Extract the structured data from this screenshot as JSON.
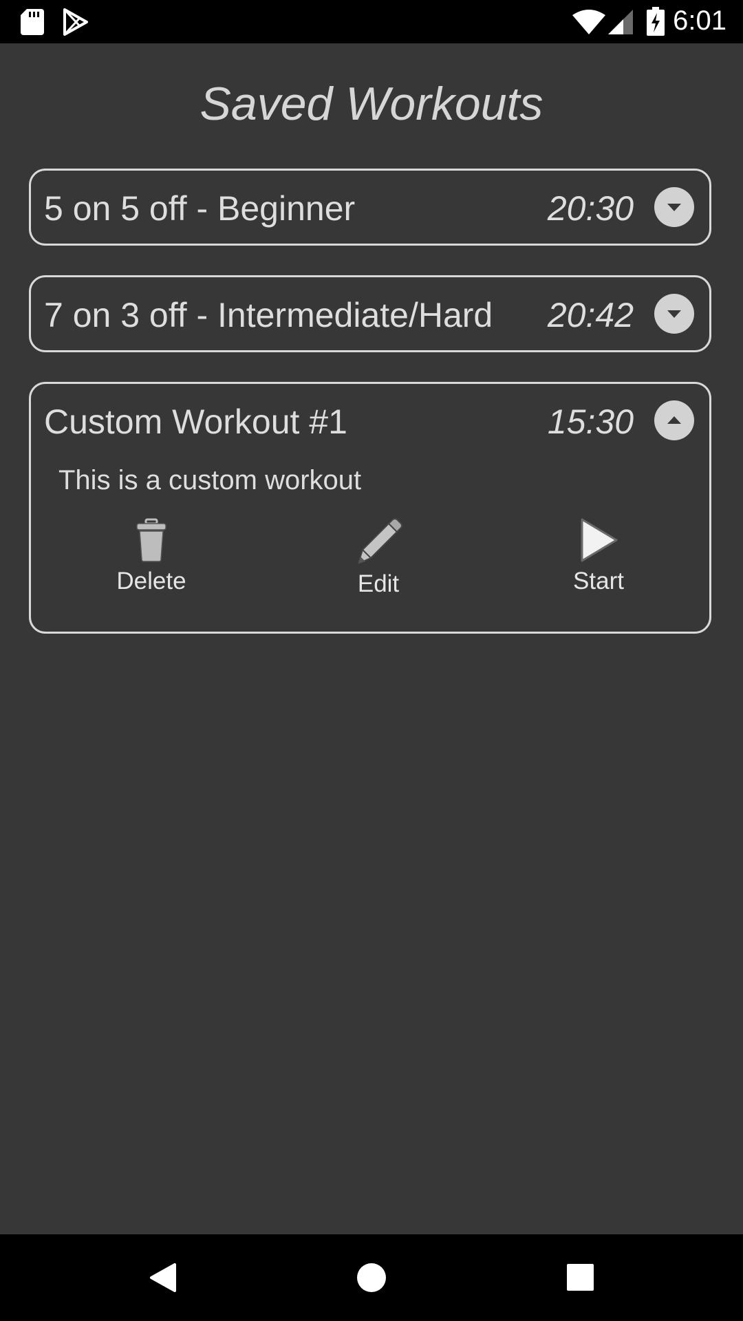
{
  "status_bar": {
    "time": "6:01",
    "icons": [
      "sd-card-icon",
      "play-store-icon",
      "wifi-icon",
      "signal-icon",
      "battery-icon"
    ]
  },
  "page": {
    "title": "Saved Workouts"
  },
  "workouts": [
    {
      "name": "5 on 5 off - Beginner",
      "duration": "20:30",
      "expanded": false,
      "toggle_icon": "chevron-down-icon"
    },
    {
      "name": "7 on 3 off - Intermediate/Hard",
      "duration": "20:42",
      "expanded": false,
      "toggle_icon": "chevron-down-icon"
    },
    {
      "name": "Custom Workout #1",
      "duration": "15:30",
      "expanded": true,
      "toggle_icon": "chevron-up-icon",
      "description": "This is a custom workout",
      "actions": [
        {
          "label": "Delete",
          "icon": "trash-icon"
        },
        {
          "label": "Edit",
          "icon": "pencil-icon"
        },
        {
          "label": "Start",
          "icon": "play-icon"
        }
      ]
    }
  ],
  "nav_bar": {
    "icons": [
      "back-icon",
      "home-icon",
      "recents-icon"
    ]
  },
  "colors": {
    "background": "#373737",
    "card_border": "#d9d9d9",
    "text": "#dedede",
    "bars": "#000000"
  }
}
